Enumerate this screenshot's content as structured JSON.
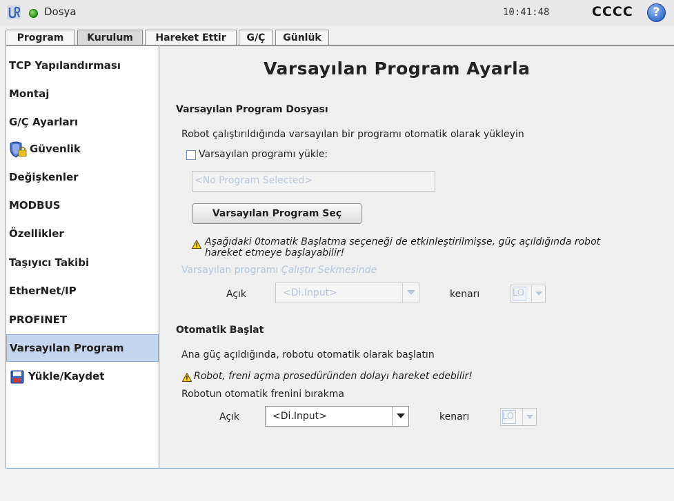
{
  "topbar": {
    "app_title": "Dosya",
    "clock": "10:41:48",
    "robot_name": "CCCC",
    "help_label": "?"
  },
  "tabs": [
    {
      "label": "Program",
      "active": false
    },
    {
      "label": "Kurulum",
      "active": true
    },
    {
      "label": "Hareket Ettir",
      "active": false
    },
    {
      "label": "G/Ç",
      "active": false
    },
    {
      "label": "Günlük",
      "active": false
    }
  ],
  "sidebar": {
    "items": [
      {
        "label": "TCP Yapılandırması"
      },
      {
        "label": "Montaj"
      },
      {
        "label": "G/Ç Ayarları"
      },
      {
        "label": "Güvenlik",
        "icon": "shield-lock-icon"
      },
      {
        "label": "Değişkenler"
      },
      {
        "label": "MODBUS"
      },
      {
        "label": "Özellikler"
      },
      {
        "label": "Taşıyıcı Takibi"
      },
      {
        "label": "EtherNet/IP"
      },
      {
        "label": "PROFINET"
      },
      {
        "label": "Varsayılan Program",
        "active": true
      },
      {
        "label": "Yükle/Kaydet",
        "icon": "floppy-disk-icon"
      }
    ]
  },
  "main": {
    "page_title": "Varsayılan Program Ayarla",
    "default_file": {
      "section_title": "Varsayılan Program Dosyası",
      "description": "Robot çalıştırıldığında varsayılan bir programı otomatik olarak yükleyin",
      "load_checkbox_label": "Varsayılan programı yükle:",
      "load_checkbox_checked": false,
      "program_field_value": "<No Program Selected>",
      "select_button_label": "Varsayılan Program Seç",
      "warning_line1": "Aşağıdaki 0tomatik Başlatma seçeneği de etkinleştirilmişse, güç açıldığında robot",
      "warning_line2": "hareket etmeye başlayabilir!",
      "run_tab_prefix": "Varsayılan programı ",
      "run_tab_italic": "Çalıştır Sekmesinde",
      "on_label": "Açık",
      "input_value": "<Di.Input>",
      "edge_label": "kenarı",
      "edge_value": "LO"
    },
    "autostart": {
      "section_title": "Otomatik Başlat",
      "description": "Ana güç açıldığında, robotu otomatik olarak başlatın",
      "warning": "Robot, freni açma prosedüründen dolayı hareket edebilir!",
      "brake_release_label": "Robotun otomatik frenini bırakma",
      "on_label": "Açık",
      "input_value": "<Di.Input>",
      "edge_label": "kenarı",
      "edge_value": "LO"
    }
  },
  "colors": {
    "accent_active": "#c3d6ee",
    "status_green": "#2a8f16",
    "help_blue": "#2f67c7",
    "disabled_text": "#b7c8dd"
  }
}
